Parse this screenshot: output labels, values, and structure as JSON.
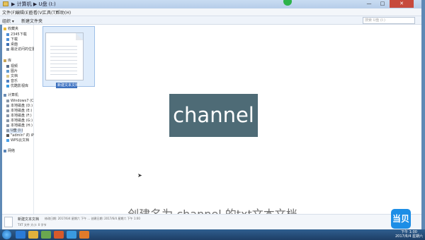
{
  "window": {
    "title": "▶ 计算机 ▶ U盘 (I:)",
    "min_label": "—",
    "max_label": "□",
    "close_label": "✕"
  },
  "menu": [
    "文件(F)",
    "编辑(E)",
    "查看(V)",
    "工具(T)",
    "帮助(H)"
  ],
  "toolbar": {
    "organize_label": "组织 ▾",
    "new_folder_label": "新建文件夹",
    "search_placeholder": "搜索 U盘 (I:)"
  },
  "nav": {
    "favorites_header": "收藏夹",
    "favorites": [
      "2345下载",
      "下载",
      "桌面",
      "最近访问的位置"
    ],
    "libraries_header": "库",
    "libraries": [
      "视频",
      "图片",
      "文档",
      "音乐",
      "优酷影视库"
    ],
    "computer_header": "计算机",
    "drives": [
      "Windows7 (C:)",
      "本地磁盘 (D:)",
      "本地磁盘 (E:)",
      "本地磁盘 (F:)",
      "本地磁盘 (G:)",
      "本地磁盘 (H:)",
      "U盘 (I:)",
      "\"admin\" 的 iPhone",
      "WPS云文档"
    ],
    "network_header": "网络"
  },
  "file": {
    "rename_value": "新建文本文档"
  },
  "overlay": {
    "text": "channel"
  },
  "caption": {
    "text": "创建名为 channel 的txt文本文档"
  },
  "details": {
    "name": "新建文本文档",
    "info": "修改日期: 2017/6/4 星期六 下午 ... 创建日期: 2017/6/4 星期六 下午 1:00",
    "type_size": "TXT 文件   大小: 0 字节"
  },
  "taskbar": {
    "time": "下午 1:00",
    "date": "2017/6/4 星期六"
  },
  "logo": {
    "text": "当贝"
  },
  "colors": {
    "overlay_bg": "#4e6b76",
    "selection": "#3d73c4",
    "taskbar": "#1e3f66"
  }
}
